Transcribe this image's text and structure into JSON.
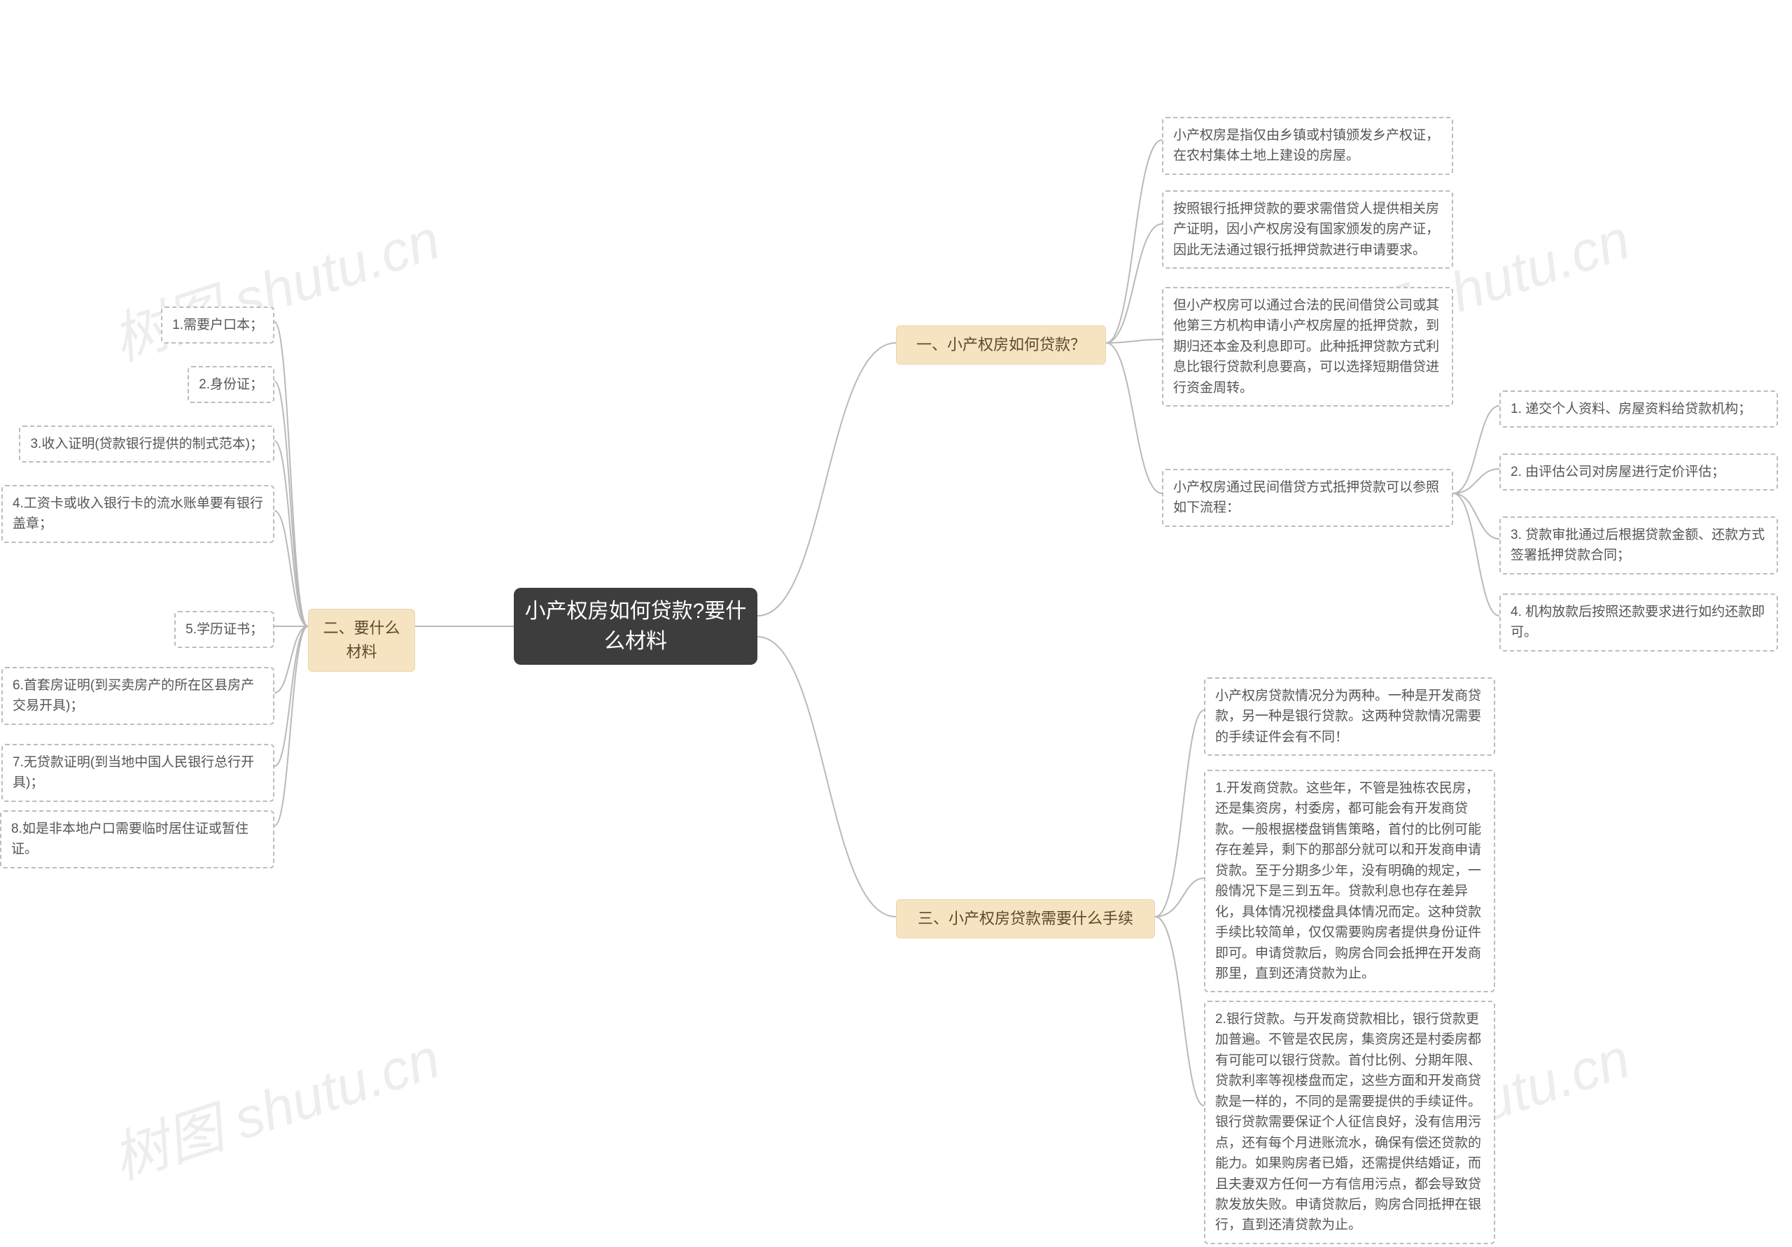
{
  "root": "小产权房如何贷款?要什么材料",
  "branches": {
    "b1": "一、小产权房如何贷款？",
    "b2": "二、要什么材料",
    "b3": "三、小产权房贷款需要什么手续"
  },
  "b1_leaves": {
    "l1": "小产权房是指仅由乡镇或村镇颁发乡产权证，在农村集体土地上建设的房屋。",
    "l2": "按照银行抵押贷款的要求需借贷人提供相关房产证明，因小产权房没有国家颁发的房产证，因此无法通过银行抵押贷款进行申请要求。",
    "l3": "但小产权房可以通过合法的民间借贷公司或其他第三方机构申请小产权房屋的抵押贷款，到期归还本金及利息即可。此种抵押贷款方式利息比银行贷款利息要高，可以选择短期借贷进行资金周转。",
    "l4": "小产权房通过民间借贷方式抵押贷款可以参照如下流程：",
    "l4_sub": {
      "s1": "1. 递交个人资料、房屋资料给贷款机构；",
      "s2": "2. 由评估公司对房屋进行定价评估；",
      "s3": "3. 贷款审批通过后根据贷款金额、还款方式签署抵押贷款合同；",
      "s4": "4. 机构放款后按照还款要求进行如约还款即可。"
    }
  },
  "b2_leaves": {
    "m1": "1.需要户口本；",
    "m2": "2.身份证；",
    "m3": "3.收入证明(贷款银行提供的制式范本)；",
    "m4": "4.工资卡或收入银行卡的流水账单要有银行盖章；",
    "m5": "5.学历证书；",
    "m6": "6.首套房证明(到买卖房产的所在区县房产交易开具)；",
    "m7": "7.无贷款证明(到当地中国人民银行总行开具)；",
    "m8": "8.如是非本地户口需要临时居住证或暂住证。"
  },
  "b3_leaves": {
    "p0": "小产权房贷款情况分为两种。一种是开发商贷款，另一种是银行贷款。这两种贷款情况需要的手续证件会有不同！",
    "p1": "1.开发商贷款。这些年，不管是独栋农民房，还是集资房，村委房，都可能会有开发商贷款。一般根据楼盘销售策略，首付的比例可能存在差异，剩下的那部分就可以和开发商申请贷款。至于分期多少年，没有明确的规定，一般情况下是三到五年。贷款利息也存在差异化，具体情况视楼盘具体情况而定。这种贷款手续比较简单，仅仅需要购房者提供身份证件即可。申请贷款后，购房合同会抵押在开发商那里，直到还清贷款为止。",
    "p2": "2.银行贷款。与开发商贷款相比，银行贷款更加普遍。不管是农民房，集资房还是村委房都有可能可以银行贷款。首付比例、分期年限、贷款利率等视楼盘而定，这些方面和开发商贷款是一样的，不同的是需要提供的手续证件。银行贷款需要保证个人征信良好，没有信用污点，还有每个月进账流水，确保有偿还贷款的能力。如果购房者已婚，还需提供结婚证，而且夫妻双方任何一方有信用污点，都会导致贷款发放失败。申请贷款后，购房合同抵押在银行，直到还清贷款为止。"
  },
  "watermarks": [
    "树图 shutu.cn",
    "树图 shutu.cn",
    "树图 shutu.cn",
    "树图 shutu.cn"
  ]
}
